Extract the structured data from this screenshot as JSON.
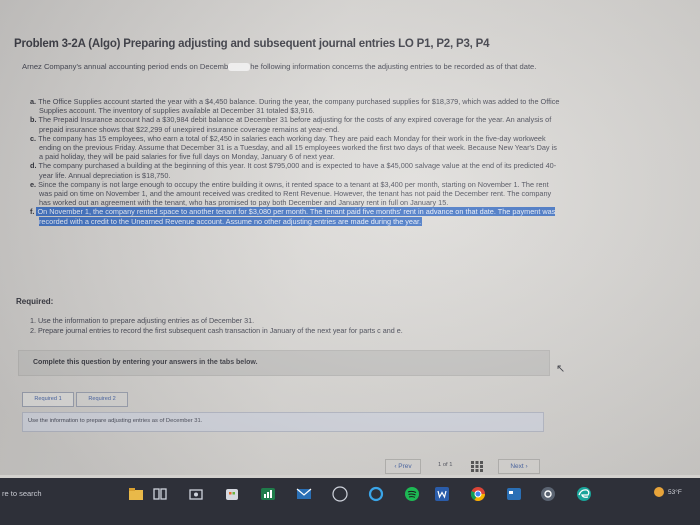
{
  "problem": {
    "title": "Problem 3-2A (Algo) Preparing adjusting and subsequent journal entries LO P1, P2, P3, P4",
    "intro_before": "Arnez Company's annual accounting period ends on Decemb",
    "intro_after": "he following information concerns the adjusting entries to be recorded as of that date."
  },
  "items": [
    {
      "letter": "a.",
      "text": "The Office Supplies account started the year with a $4,450 balance. During the year, the company purchased supplies for $18,379, which was added to the Office Supplies account. The inventory of supplies available at December 31 totaled $3,916."
    },
    {
      "letter": "b.",
      "text": "The Prepaid Insurance account had a $30,984 debit balance at December 31 before adjusting for the costs of any expired coverage for the year. An analysis of prepaid insurance shows that $22,299 of unexpired insurance coverage remains at year-end."
    },
    {
      "letter": "c.",
      "text": "The company has 15 employees, who earn a total of $2,450 in salaries each working day. They are paid each Monday for their work in the five-day workweek ending on the previous Friday. Assume that December 31 is a Tuesday, and all 15 employees worked the first two days of that week. Because New Year's Day is a paid holiday, they will be paid salaries for five full days on Monday, January 6 of next year."
    },
    {
      "letter": "d.",
      "text": "The company purchased a building at the beginning of this year. It cost $795,000 and is expected to have a $45,000 salvage value at the end of its predicted 40-year life. Annual depreciation is $18,750."
    },
    {
      "letter": "e.",
      "text": "Since the company is not large enough to occupy the entire building it owns, it rented space to a tenant at $3,400 per month, starting on November 1. The rent was paid on time on November 1, and the amount received was credited to Rent Revenue. However, the tenant has not paid the December rent. The company has worked out an agreement with the tenant, who has promised to pay both December and January rent in full on January 15."
    },
    {
      "letter": "f.",
      "text": "On November 1, the company rented space to another tenant for $3,080 per month. The tenant paid five months' rent in advance on that date. The payment was recorded with a credit to the Unearned Revenue account. Assume no other adjusting entries are made during the year."
    }
  ],
  "required": {
    "label": "Required:",
    "items": [
      "1. Use the information to prepare adjusting entries as of December 31.",
      "2. Prepare journal entries to record the first subsequent cash transaction in January of the next year for parts c and e."
    ]
  },
  "instructions": {
    "complete_text": "Complete this question by entering your answers in the tabs below."
  },
  "tabs": [
    {
      "label": "Required 1"
    },
    {
      "label": "Required 2"
    }
  ],
  "tab_instruction": "Use the information to prepare adjusting entries as of December 31.",
  "pagination": {
    "prev": "Prev",
    "page_text": "1 of 1",
    "next": "Next"
  },
  "taskbar": {
    "search_text": "re to search",
    "weather": "53°F"
  },
  "colors": {
    "accent": "#3c6fc2",
    "taskbar": "#2e3039"
  }
}
